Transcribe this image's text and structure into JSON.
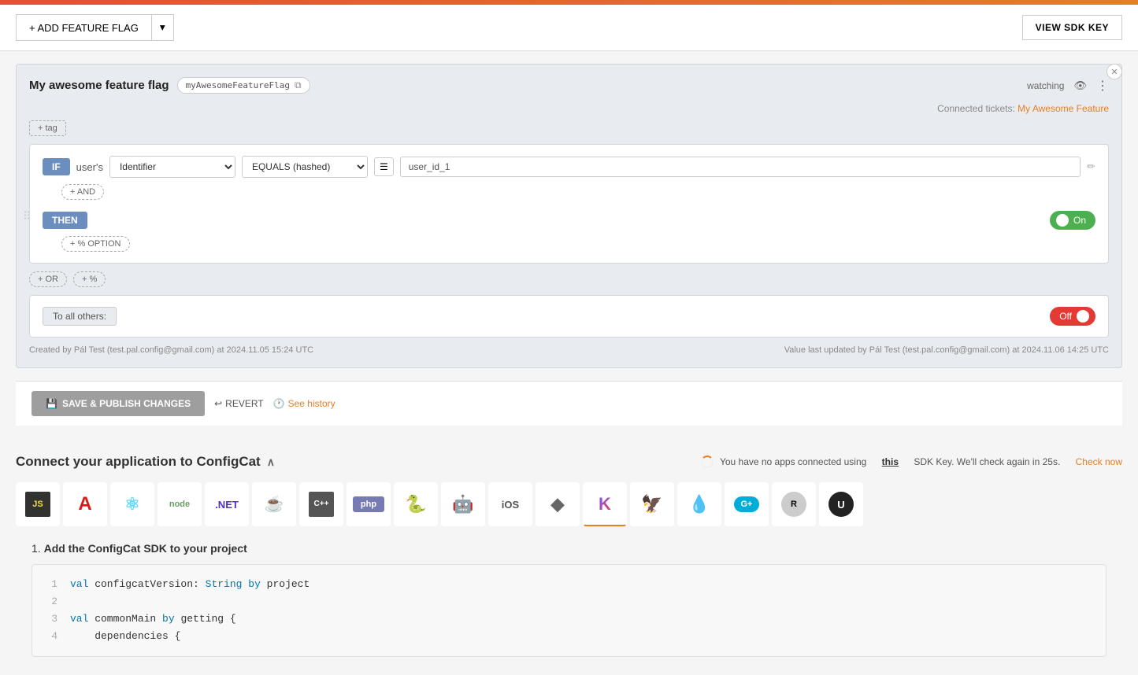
{
  "topbar": {
    "color": "#e74c3c"
  },
  "toolbar": {
    "add_flag_label": "+ ADD FEATURE FLAG",
    "view_sdk_label": "VIEW SDK KEY"
  },
  "flag": {
    "title": "My awesome feature flag",
    "key": "myAwesomeFeatureFlag",
    "watching_label": "watching",
    "connected_tickets_label": "Connected tickets:",
    "connected_ticket_name": "My Awesome Feature",
    "tag_btn": "+ tag",
    "rule": {
      "if_label": "IF",
      "user_label": "user's",
      "identifier_label": "Identifier",
      "equals_hashed_label": "EQUALS (hashed)",
      "value": "user_id_1",
      "and_btn": "+ AND",
      "then_label": "THEN",
      "toggle_on_label": "On",
      "option_btn": "+ % OPTION",
      "or_btn": "+ OR",
      "percent_btn": "+ %"
    },
    "others": {
      "label": "To all others:",
      "toggle_off_label": "Off"
    },
    "footer": {
      "created_by": "Created by Pál Test (test.pal.config@gmail.com) at 2024.11.05 15:24 UTC",
      "updated_by": "Value last updated by Pál Test (test.pal.config@gmail.com) at 2024.11.06 14:25 UTC"
    }
  },
  "actions": {
    "save_label": "SAVE & PUBLISH CHANGES",
    "revert_label": "REVERT",
    "history_label": "See history"
  },
  "connect": {
    "title": "Connect your application to ConfigCat",
    "status_text": "You have no apps connected using",
    "status_link": "this",
    "status_text2": "SDK Key. We'll check again in 25s.",
    "check_now": "Check now"
  },
  "sdks": [
    {
      "id": "js",
      "label": "JS",
      "icon": "JS",
      "color": "#f0db4f",
      "bg": "#323330",
      "active": false
    },
    {
      "id": "angular",
      "label": "",
      "icon": "A",
      "color": "#dd1b16",
      "active": false
    },
    {
      "id": "react",
      "label": "",
      "icon": "⚛",
      "color": "#61dafb",
      "active": false
    },
    {
      "id": "node",
      "label": "",
      "icon": "node",
      "color": "#68a063",
      "active": false
    },
    {
      "id": "dotnet",
      "label": "",
      "icon": ".NET",
      "color": "#512bd4",
      "active": false
    },
    {
      "id": "java",
      "label": "Java",
      "icon": "☕",
      "color": "#e76f00",
      "active": false
    },
    {
      "id": "cpp",
      "label": "",
      "icon": "C++",
      "color": "#004482",
      "active": false
    },
    {
      "id": "php",
      "label": "",
      "icon": "php",
      "color": "#777bb3",
      "active": false
    },
    {
      "id": "python",
      "label": "",
      "icon": "🐍",
      "color": "#3572A5",
      "active": false
    },
    {
      "id": "android",
      "label": "",
      "icon": "🤖",
      "color": "#3ddc84",
      "active": false
    },
    {
      "id": "ios",
      "label": "iOS",
      "icon": "",
      "color": "#555",
      "active": false
    },
    {
      "id": "dart",
      "label": "",
      "icon": "◆",
      "color": "#0175C2",
      "active": false
    },
    {
      "id": "kotlin",
      "label": "",
      "icon": "K",
      "color": "#7F52FF",
      "active": true
    },
    {
      "id": "swift",
      "label": "",
      "icon": "🦅",
      "color": "#f05138",
      "active": false
    },
    {
      "id": "elixir",
      "label": "",
      "icon": "💧",
      "color": "#6e4a7e",
      "active": false
    },
    {
      "id": "go",
      "label": "",
      "icon": "G+",
      "color": "#00add8",
      "active": false
    },
    {
      "id": "rust",
      "label": "",
      "icon": "R",
      "color": "#000",
      "active": false
    },
    {
      "id": "unreal",
      "label": "",
      "icon": "U",
      "color": "#1f1f1f",
      "active": false
    }
  ],
  "code": {
    "step_label": "1.",
    "step_title": "Add the ConfigCat SDK to your project",
    "lines": [
      {
        "num": "1",
        "text": "val configcatVersion: String by project"
      },
      {
        "num": "2",
        "text": ""
      },
      {
        "num": "3",
        "text": "val commonMain by getting {"
      },
      {
        "num": "4",
        "text": "    dependencies {"
      }
    ]
  }
}
